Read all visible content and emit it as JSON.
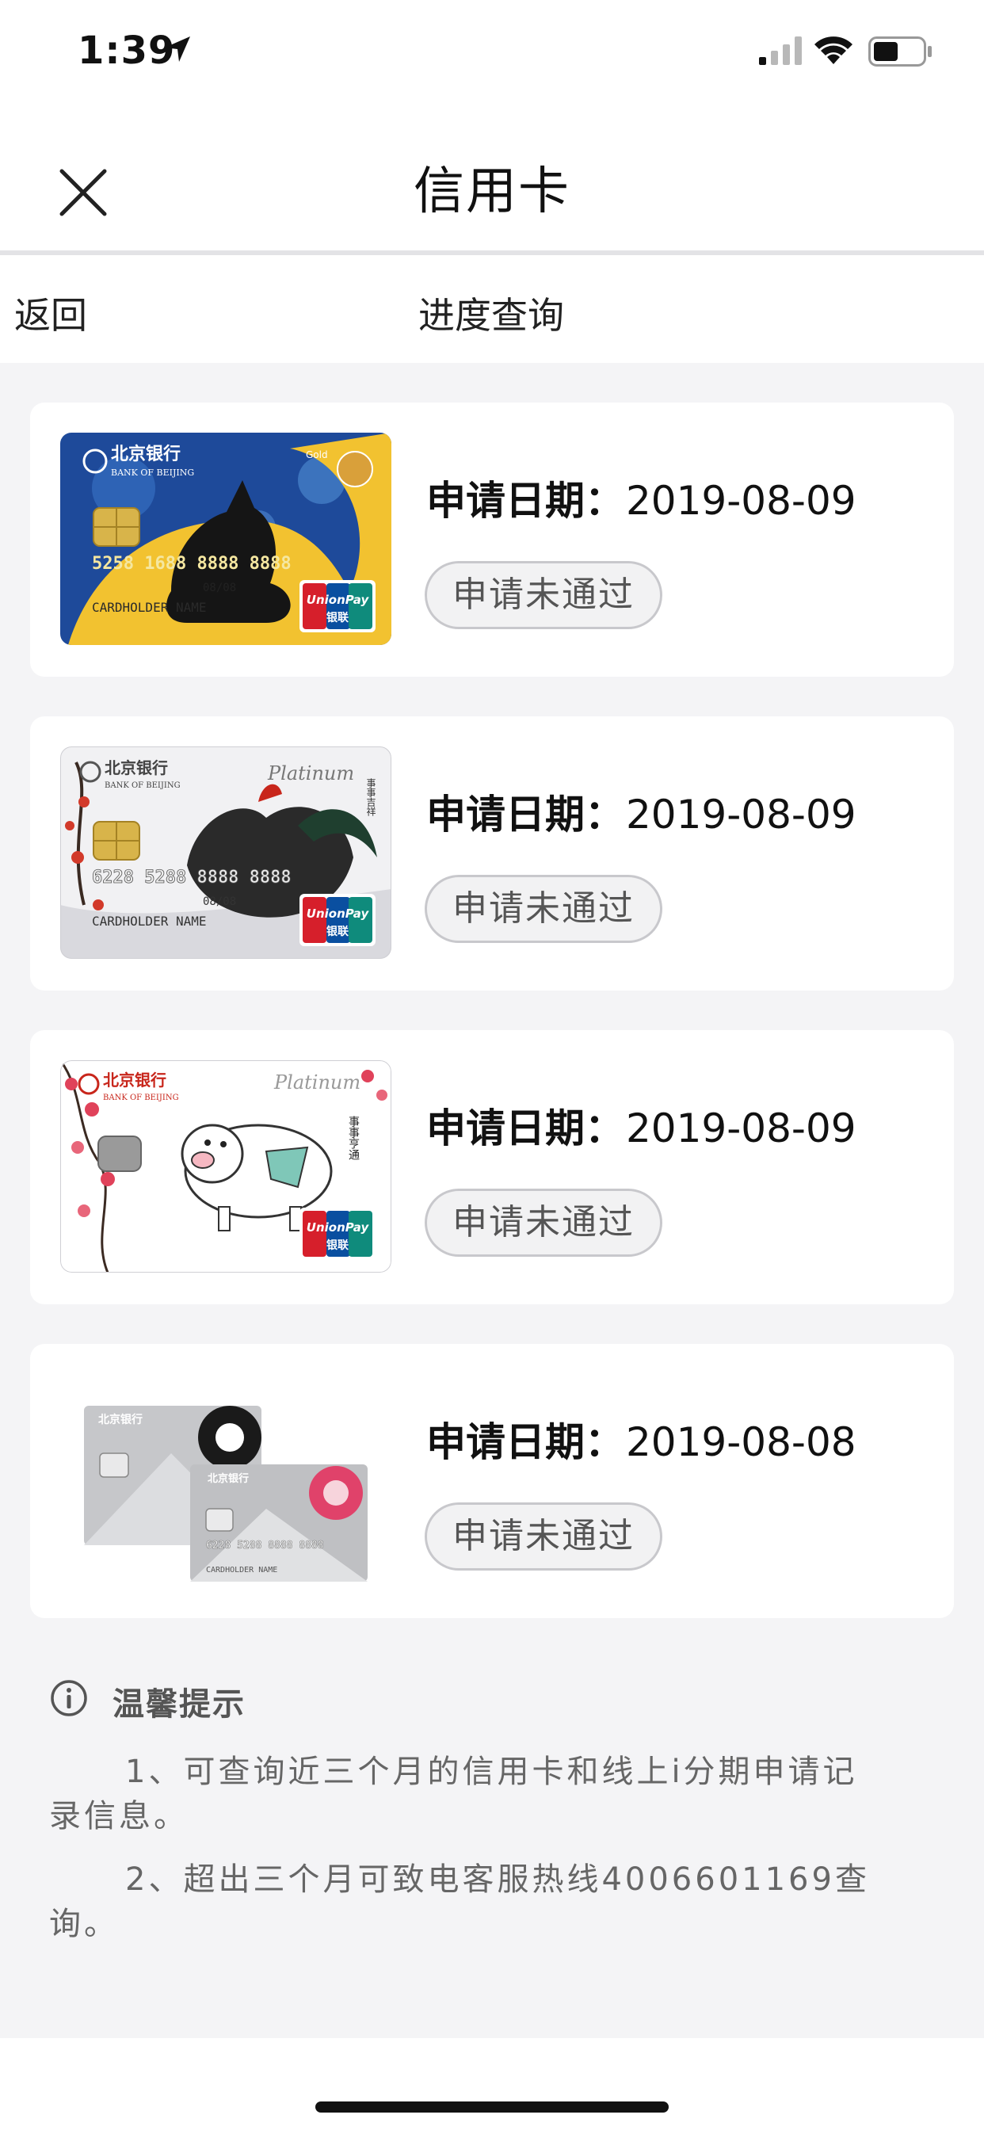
{
  "status_bar": {
    "time": "1:39"
  },
  "nav": {
    "title": "信用卡"
  },
  "subbar": {
    "back": "返回",
    "title": "进度查询"
  },
  "applications": [
    {
      "card": "gold-dog-card",
      "date_label": "申请日期：",
      "date": "2019-08-09",
      "status": "申请未通过"
    },
    {
      "card": "platinum-rooster-card",
      "date_label": "申请日期：",
      "date": "2019-08-09",
      "status": "申请未通过"
    },
    {
      "card": "platinum-pig-card",
      "date_label": "申请日期：",
      "date": "2019-08-09",
      "status": "申请未通过"
    },
    {
      "card": "silver-flower-cards",
      "date_label": "申请日期：",
      "date": "2019-08-08",
      "status": "申请未通过"
    }
  ],
  "card_texts": {
    "bank_cn": "北京银行",
    "bank_en": "BANK OF BEIJING",
    "unionpay": "UnionPay",
    "yinlian": "银联",
    "gold": "Gold",
    "platinum": "Platinum",
    "holder": "CARDHOLDER NAME",
    "number1": "5258 1688 8888 8888",
    "number2": "6228 5288 8888 8888",
    "valid": "08/08",
    "pig_motto": "事事亨通",
    "rooster_motto": "事事吉祥"
  },
  "tips": {
    "title": "温馨提示",
    "items": [
      "1、可查询近三个月的信用卡和线上i分期申请记录信息。",
      "2、超出三个月可致电客服热线4006601169查询。"
    ]
  },
  "icons": [
    "location-arrow-icon",
    "cellular-signal-icon",
    "wifi-icon",
    "battery-icon",
    "close-icon",
    "info-icon"
  ]
}
